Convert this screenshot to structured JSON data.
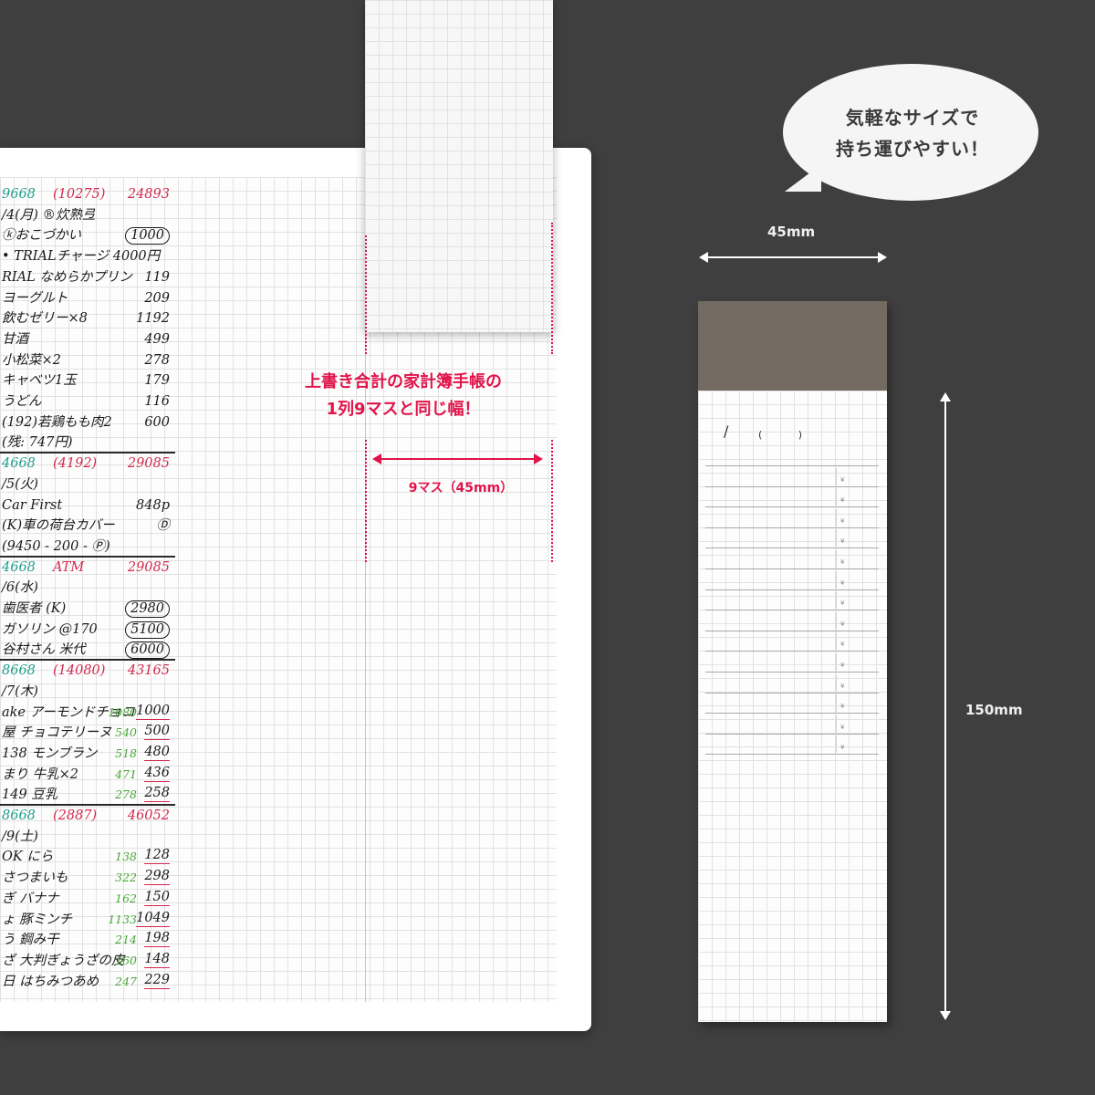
{
  "bubble": {
    "line1": "気軽なサイズで",
    "line2": "持ち運びやすい！"
  },
  "headline": {
    "line1": "上書き合計の家計簿手帳の",
    "line2": "1列9マスと同じ幅！"
  },
  "width_label": "9マス（45mm）",
  "pad_dimensions": {
    "width": "45mm",
    "height": "150mm"
  },
  "pad_template": {
    "date_mark": "/",
    "paren_mark": "(  )",
    "yen_mark": "¥"
  },
  "colors": {
    "background": "#3f3f3f",
    "accent_red": "#e0144a",
    "ink_teal": "#1f9e8e",
    "ink_green": "#49a836",
    "pad_cover": "#736a62"
  },
  "notebook_lines": [
    {
      "style": "hdr teal",
      "left": "9668",
      "mid": "(10275)",
      "right": "24893"
    },
    {
      "style": "",
      "left": "/4(月) ®炊熟弖",
      "right": ""
    },
    {
      "style": "oval",
      "left": "ⓚおこづかい",
      "right": "1000"
    },
    {
      "style": "",
      "left": "• TRIALチャージ 4000円",
      "right": ""
    },
    {
      "style": "",
      "left": "RIAL なめらかプリン",
      "right": "119"
    },
    {
      "style": "",
      "left": "     ヨーグルト",
      "right": "209"
    },
    {
      "style": "",
      "left": "   飲むゼリー×8",
      "right": "1192"
    },
    {
      "style": "",
      "left": "     甘酒",
      "right": "499"
    },
    {
      "style": "",
      "left": "   小松菜×2",
      "right": "278"
    },
    {
      "style": "",
      "left": "     キャベツ1玉",
      "right": "179"
    },
    {
      "style": "",
      "left": "     うどん",
      "right": "116"
    },
    {
      "style": "",
      "left": "(192)若鶏もも肉2",
      "right": "600"
    },
    {
      "style": "rule",
      "left": "   (残: 747円)",
      "right": ""
    },
    {
      "style": "hdr teal",
      "left": "4668",
      "mid": "(4192)",
      "right": "29085"
    },
    {
      "style": "",
      "left": "/5(火)",
      "right": ""
    },
    {
      "style": "",
      "left": "   Car First",
      "right": "848p"
    },
    {
      "style": "",
      "left": "(K)車の荷台カバー",
      "right": "Ⓓ"
    },
    {
      "style": "rule",
      "left": "(9450 - 200 - Ⓟ)",
      "right": ""
    },
    {
      "style": "hdr teal",
      "left": "4668",
      "mid": "ATM",
      "right": "29085"
    },
    {
      "style": "",
      "left": "/6(水)",
      "right": ""
    },
    {
      "style": "oval",
      "left": "歯医者 (K)",
      "right": "2980"
    },
    {
      "style": "oval",
      "left": "ガソリン @170",
      "right": "5100"
    },
    {
      "style": "oval rule",
      "left": "谷村さん 米代",
      "right": "6000"
    },
    {
      "style": "hdr teal",
      "left": "8668",
      "mid": "(14080)",
      "right": "43165"
    },
    {
      "style": "",
      "left": "/7(木)",
      "right": ""
    },
    {
      "style": "under",
      "left": "ake アーモンドチョコ",
      "green": "1080",
      "right": "1000"
    },
    {
      "style": "under",
      "left": "屋 チョコテリーヌ",
      "green": "540",
      "right": "500"
    },
    {
      "style": "under",
      "left": "138 モンブラン",
      "green": "518",
      "right": "480"
    },
    {
      "style": "under",
      "left": "まり 牛乳×2",
      "green": "471",
      "right": "436"
    },
    {
      "style": "under rule",
      "left": "149 豆乳",
      "green": "278",
      "right": "258"
    },
    {
      "style": "hdr teal",
      "left": "8668",
      "mid": "(2887)",
      "right": "46052"
    },
    {
      "style": "",
      "left": "/9(土)",
      "right": ""
    },
    {
      "style": "under",
      "left": "OK  にら",
      "green": "138",
      "right": "128"
    },
    {
      "style": "under",
      "left": "    さつまいも",
      "green": "322",
      "right": "298"
    },
    {
      "style": "under",
      "left": "ぎ  バナナ",
      "green": "162",
      "right": "150"
    },
    {
      "style": "under",
      "left": "ょ  豚ミンチ",
      "green": "1133",
      "right": "1049"
    },
    {
      "style": "under",
      "left": "う  鋼み干",
      "green": "214",
      "right": "198"
    },
    {
      "style": "under",
      "left": "ざ 大判ぎょうざの皮",
      "green": "160",
      "right": "148"
    },
    {
      "style": "under",
      "left": "日 はちみつあめ",
      "green": "247",
      "right": "229"
    }
  ]
}
